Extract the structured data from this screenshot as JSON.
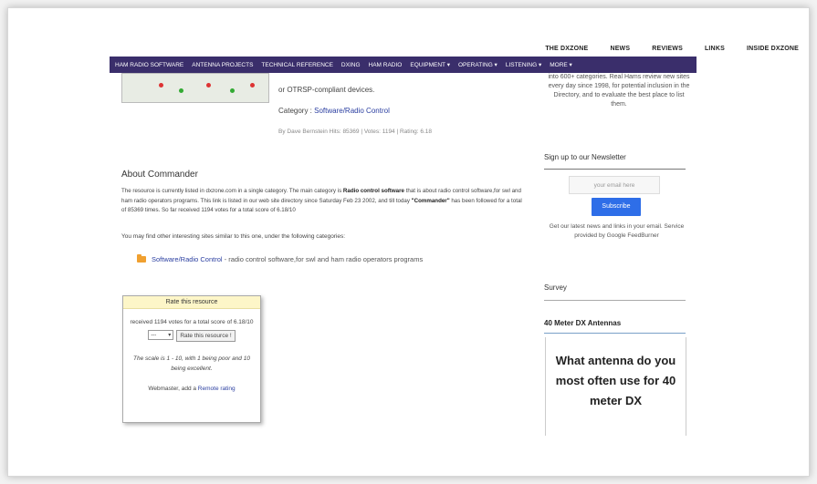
{
  "topnav": [
    "THE DXZONE",
    "NEWS",
    "REVIEWS",
    "LINKS",
    "INSIDE DXZONE"
  ],
  "mainnav": [
    "HAM RADIO SOFTWARE",
    "ANTENNA PROJECTS",
    "TECHNICAL REFERENCE",
    "DXING",
    "HAM RADIO",
    "EQUIPMENT ▾",
    "OPERATING ▾",
    "LISTENING ▾",
    "MORE ▾"
  ],
  "resource": {
    "text_tail": "or OTRSP-compliant devices.",
    "category_label": "Category : ",
    "category_link": "Software/Radio Control",
    "byline": "By Dave Bernstein Hits: 85369 | Votes: 1194 | Rating: 6.18"
  },
  "about": {
    "title": "About Commander",
    "p1": "The resource is currently listed in dxzone.com in a single category. The main category is ",
    "p1_bold": "Radio control software",
    "p2": " that is about radio control software,for swl and ham radio operators programs. This link is listed in our web site directory since Saturday Feb 23 2002, and till today ",
    "p2_bold": "\"Commander\"",
    "p3": " has been followed for a total of 85369 times. So far received 1194 votes for a total score of 6.18/10",
    "similar": "You may find other interesting sites similar to this one, under the following categories:",
    "cat_link": "Software/Radio Control",
    "cat_desc": " - radio control software,for swl and ham radio operators programs"
  },
  "rate": {
    "header": "Rate this resource",
    "votes": "received 1194 votes for a total score of 6.18/10",
    "select_value": "---",
    "button": "Rate this resource !",
    "scale_a": "The scale is 1 - 10, with ",
    "scale_poor_num": "1",
    "scale_b": " being poor and ",
    "scale_exc_num": "10",
    "scale_c": " being excellent.",
    "remote_prefix": "Webmaster, add a ",
    "remote_link": "Remote rating"
  },
  "sidebar": {
    "top_text": "into 600+ categories. Real Hams review new sites every day since 1998, for potential inclusion in the Directory, and to evaluate the best place to list them.",
    "newsletter_title": "Sign up to our Newsletter",
    "email_placeholder": "your email here",
    "subscribe": "Subscribe",
    "newsletter_desc": "Get our latest news and links in your email. Service provided by Google FeedBurner",
    "survey_title": "Survey",
    "dx_title": "40 Meter DX Antennas",
    "dx_question": "What antenna do you most often use for 40 meter DX"
  },
  "colors": {
    "nav_bg": "#3a2e6b",
    "link": "#2a3ea0",
    "subscribe_bg": "#2e6ee8",
    "rate_header_bg": "#fdf6c8"
  }
}
